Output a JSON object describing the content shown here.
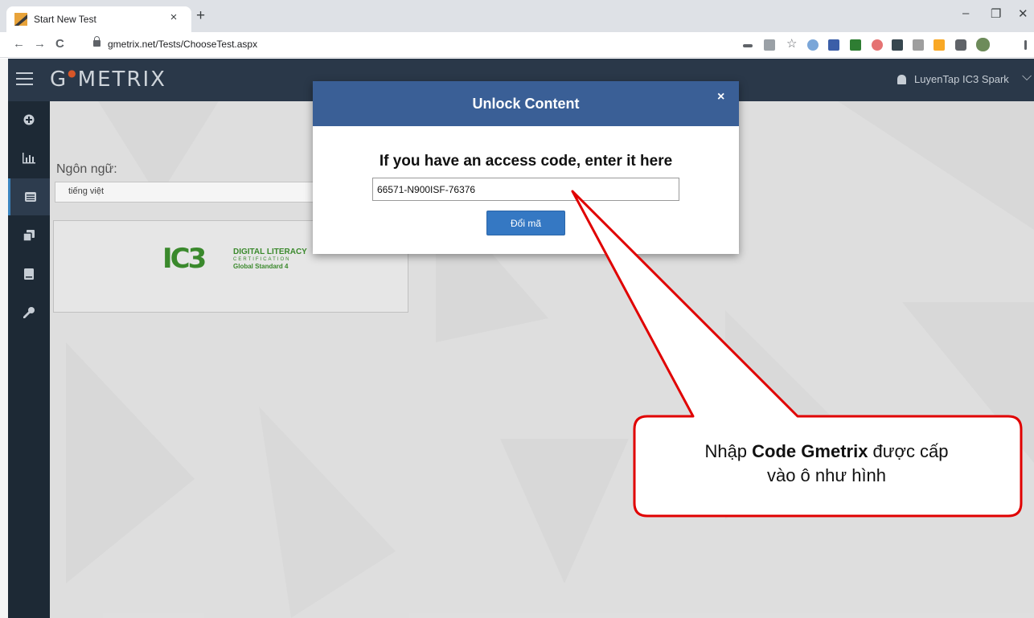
{
  "browser": {
    "tab_title": "Start New Test",
    "tab_close": "×",
    "new_tab": "+",
    "url": "gmetrix.net/Tests/ChooseTest.aspx",
    "window_controls": [
      "–",
      "❐",
      "✕"
    ],
    "nav": {
      "back": "←",
      "forward": "→",
      "reload": "C"
    }
  },
  "app": {
    "brand": "G",
    "brand_rest": "METRIX",
    "brand_dot": "●",
    "user": "LuyenTap IC3 Spark",
    "user_chevron": "⌵"
  },
  "sidebar": {
    "items": [
      {
        "icon": "plus-circle-icon"
      },
      {
        "icon": "bar-chart-icon"
      },
      {
        "icon": "list-icon",
        "active": true
      },
      {
        "icon": "copy-icon"
      },
      {
        "icon": "book-icon"
      },
      {
        "icon": "key-icon"
      }
    ]
  },
  "content": {
    "language_label": "Ngôn ngữ:",
    "language_value": "tiếng việt",
    "card": {
      "logo_word": "IC3",
      "logo_line1": "DIGITAL LITERACY",
      "logo_line2": "CERTIFICATION",
      "logo_line3": "Global Standard 4"
    }
  },
  "modal": {
    "title": "Unlock Content",
    "close": "×",
    "prompt": "If you have an access code, enter it here",
    "code_value": "66571-N900ISF-76376",
    "button_label": "Đổi mã"
  },
  "callout": {
    "prefix": "Nhập ",
    "bold": "Code Gmetrix",
    "suffix": " được cấp",
    "line2": "vào ô như hình"
  },
  "colors": {
    "header": "#2c3b4c",
    "modal_header": "#3a5f96",
    "button": "#3578c3",
    "callout_border": "#e00000"
  }
}
